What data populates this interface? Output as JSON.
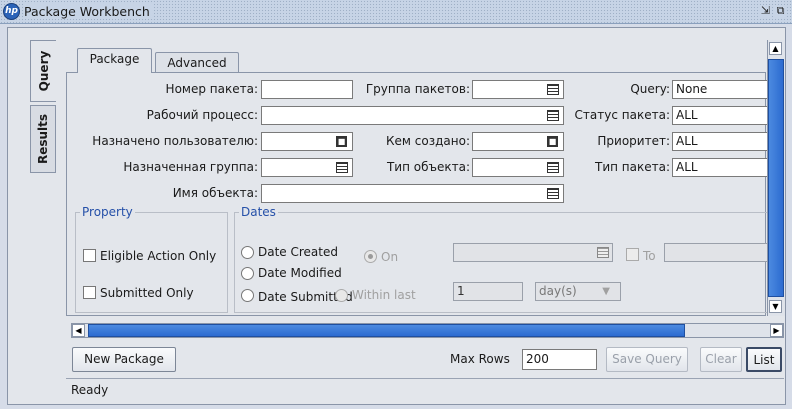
{
  "window": {
    "title": "Package Workbench",
    "restore_glyph": "⇲",
    "float_glyph": "⧉",
    "app_icon_glyph": "hp"
  },
  "side_tabs": [
    {
      "label": "Query"
    },
    {
      "label": "Results"
    }
  ],
  "tabs": [
    {
      "label": "Package",
      "active": true
    },
    {
      "label": "Advanced",
      "active": false
    }
  ],
  "form": {
    "package_number": {
      "label": "Номер пакета:",
      "value": ""
    },
    "package_group": {
      "label": "Группа пакетов:",
      "value": ""
    },
    "query": {
      "label": "Query:",
      "value": "None"
    },
    "workflow": {
      "label": "Рабочий процесс:",
      "value": ""
    },
    "package_status": {
      "label": "Статус пакета:",
      "value": "ALL"
    },
    "assigned_to": {
      "label": "Назначено пользователю:",
      "value": ""
    },
    "created_by": {
      "label": "Кем создано:",
      "value": ""
    },
    "priority": {
      "label": "Приоритет:",
      "value": "ALL"
    },
    "assigned_group": {
      "label": "Назначенная группа:",
      "value": ""
    },
    "object_type": {
      "label": "Тип объекта:",
      "value": ""
    },
    "package_type": {
      "label": "Тип пакета:",
      "value": "ALL"
    },
    "object_name": {
      "label": "Имя объекта:",
      "value": ""
    }
  },
  "property": {
    "legend": "Property",
    "eligible_action_only": {
      "label": "Eligible Action Only",
      "checked": false
    },
    "submitted_only": {
      "label": "Submitted Only",
      "checked": false
    }
  },
  "dates": {
    "legend": "Dates",
    "options": [
      "Date Created",
      "Date Modified",
      "Date Submitted"
    ],
    "on_label": "On",
    "to_label": "To",
    "within_last_label": "Within last",
    "within_last_value": "1",
    "unit_value": "day(s)",
    "on_date_value": "",
    "to_date_value": ""
  },
  "scroll": {
    "up_glyph": "▲",
    "down_glyph": "▼",
    "left_glyph": "◀",
    "right_glyph": "▶"
  },
  "footer": {
    "new_package": "New Package",
    "max_rows_label": "Max Rows",
    "max_rows_value": "200",
    "save_query": "Save Query",
    "clear": "Clear",
    "list": "List"
  },
  "status": "Ready",
  "colors": {
    "legend_blue": "#2550a8",
    "scroll_blue": "#2c6bd0",
    "titlebar": "#c7d4e6"
  }
}
